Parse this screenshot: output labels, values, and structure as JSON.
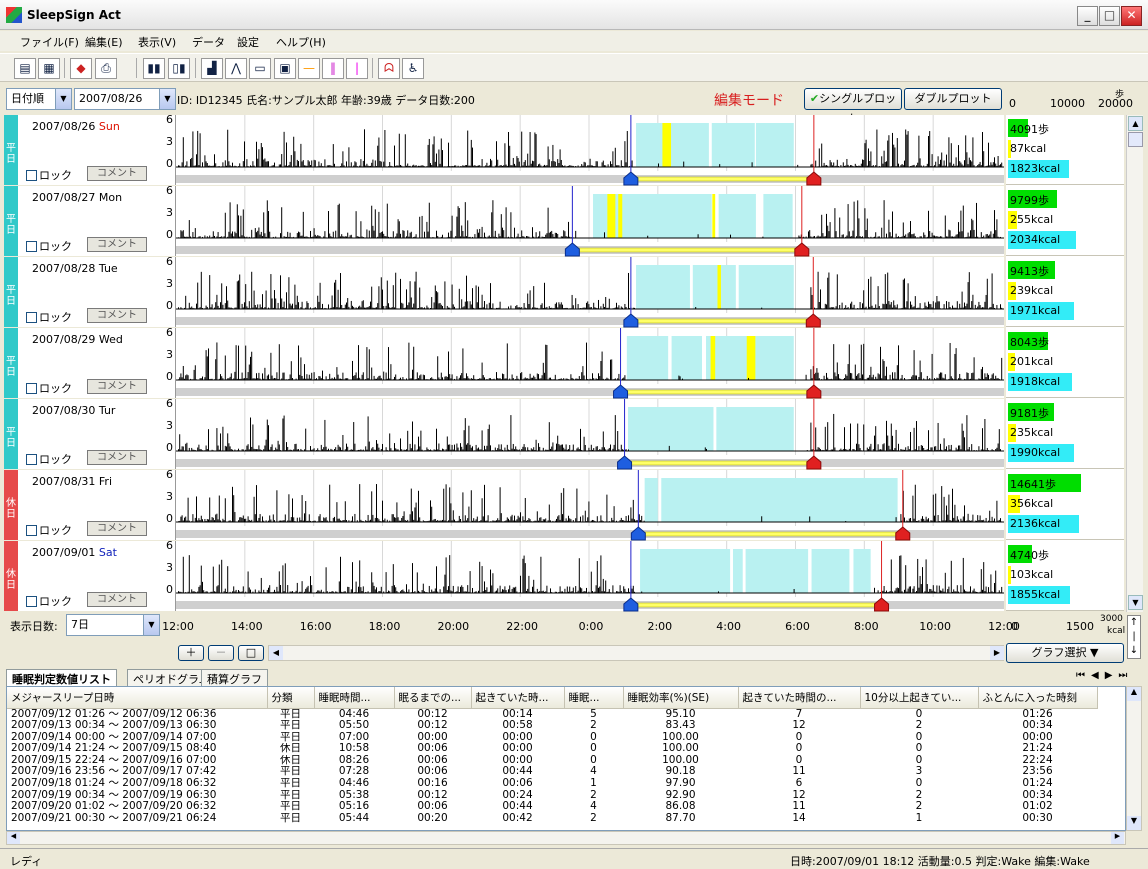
{
  "window": {
    "title": "SleepSign Act"
  },
  "menu": [
    "ファイル(F)",
    "編集(E)",
    "表示(V)",
    "データ",
    "設定",
    "ヘルプ(H)"
  ],
  "info": {
    "sort": "日付順",
    "date": "2007/08/26",
    "subject": "ID: ID12345  氏名:サンプル太郎  年齢:39歳  データ日数:200",
    "mode": "編集モード",
    "single_plot": "シングルプロット",
    "double_plot": "ダブルプロット",
    "scale_ticks": [
      "0",
      "10000",
      "20000"
    ],
    "scale_unit": "歩"
  },
  "colors": {
    "weekday": "#31c9c9",
    "holiday": "#e64a4a",
    "sleep": "#b9f1f1",
    "wake": "#ffff00",
    "steps": "#00dd00",
    "kcal": "#33ecf7",
    "mode": "#d81f1f"
  },
  "ytick": [
    "6",
    "3",
    "0"
  ],
  "rows": [
    {
      "date": "2007/08/26",
      "dow": "Sun",
      "dowclass": "sun",
      "day": "平日",
      "steps": "4091歩",
      "act": "87kcal",
      "total": "1823kcal",
      "stepsv": 4091,
      "actv": 87,
      "totalv": 1823,
      "sleepstart": "01:13",
      "sleepend": "06:32",
      "bands": [
        [
          "01:22",
          "03:29"
        ],
        [
          "03:34",
          "04:49"
        ],
        [
          "04:51",
          "05:57"
        ]
      ],
      "wakes": [
        [
          "02:08",
          "02:23"
        ]
      ]
    },
    {
      "date": "2007/08/27",
      "dow": "Mon",
      "dowclass": "",
      "day": "平日",
      "steps": "9799歩",
      "act": "255kcal",
      "total": "2034kcal",
      "stepsv": 9799,
      "actv": 255,
      "totalv": 2034,
      "sleepstart": "23:31",
      "sleepend": "06:11",
      "bands": [
        [
          "00:07",
          "03:34"
        ],
        [
          "03:46",
          "04:51"
        ],
        [
          "05:04",
          "05:55"
        ]
      ],
      "wakes": [
        [
          "00:32",
          "00:46"
        ],
        [
          "00:51",
          "00:58"
        ],
        [
          "03:35",
          "03:40"
        ]
      ]
    },
    {
      "date": "2007/08/28",
      "dow": "Tue",
      "dowclass": "",
      "day": "平日",
      "steps": "9413歩",
      "act": "239kcal",
      "total": "1971kcal",
      "stepsv": 9413,
      "actv": 239,
      "totalv": 1971,
      "sleepstart": "01:13",
      "sleepend": "06:31",
      "bands": [
        [
          "01:22",
          "02:56"
        ],
        [
          "03:01",
          "04:16"
        ],
        [
          "04:21",
          "05:57"
        ]
      ],
      "wakes": [
        [
          "03:44",
          "03:50"
        ]
      ]
    },
    {
      "date": "2007/08/29",
      "dow": "Wed",
      "dowclass": "",
      "day": "平日",
      "steps": "8043歩",
      "act": "201kcal",
      "total": "1918kcal",
      "stepsv": 8043,
      "actv": 201,
      "totalv": 1918,
      "sleepstart": "00:55",
      "sleepend": "06:32",
      "bands": [
        [
          "01:06",
          "02:18"
        ],
        [
          "02:24",
          "03:17"
        ],
        [
          "03:24",
          "05:57"
        ]
      ],
      "wakes": [
        [
          "03:32",
          "03:40"
        ],
        [
          "04:35",
          "04:50"
        ]
      ]
    },
    {
      "date": "2007/08/30",
      "dow": "Tur",
      "dowclass": "",
      "day": "平日",
      "steps": "9181歩",
      "act": "235kcal",
      "total": "1990kcal",
      "stepsv": 9181,
      "actv": 235,
      "totalv": 1990,
      "sleepstart": "01:02",
      "sleepend": "06:32",
      "bands": [
        [
          "01:08",
          "03:37"
        ],
        [
          "03:42",
          "05:57"
        ]
      ],
      "wakes": []
    },
    {
      "date": "2007/08/31",
      "dow": "Fri",
      "dowclass": "",
      "day": "休日",
      "steps": "14641歩",
      "act": "356kcal",
      "total": "2136kcal",
      "stepsv": 14641,
      "actv": 356,
      "totalv": 2136,
      "sleepstart": "01:26",
      "sleepend": "09:07",
      "bands": [
        [
          "01:37",
          "02:00"
        ],
        [
          "02:06",
          "08:58"
        ]
      ],
      "wakes": []
    },
    {
      "date": "2007/09/01",
      "dow": "Sat",
      "dowclass": "sat",
      "day": "休日",
      "steps": "4740歩",
      "act": "103kcal",
      "total": "1855kcal",
      "stepsv": 4740,
      "actv": 103,
      "totalv": 1855,
      "sleepstart": "01:13",
      "sleepend": "08:30",
      "bands": [
        [
          "01:29",
          "04:06"
        ],
        [
          "04:11",
          "04:28"
        ],
        [
          "04:33",
          "06:22"
        ],
        [
          "06:28",
          "07:34"
        ],
        [
          "07:41",
          "08:11"
        ]
      ],
      "wakes": []
    }
  ],
  "row_labels": {
    "lock": "ロック",
    "comment": "コメント"
  },
  "display_days": {
    "label": "表示日数:",
    "value": "7日"
  },
  "time_ticks": [
    "12:00",
    "14:00",
    "16:00",
    "18:00",
    "20:00",
    "22:00",
    "0:00",
    "2:00",
    "4:00",
    "6:00",
    "8:00",
    "10:00",
    "12:00"
  ],
  "right_axis": {
    "ticks": [
      "0",
      "1500",
      "3000"
    ],
    "unit": "kcal",
    "graph_select": "グラフ選択"
  },
  "tabs": [
    "睡眠判定数値リスト",
    "ペリオドグラム",
    "積算グラフ"
  ],
  "table": {
    "headers": [
      "メジャースリープ日時",
      "分類",
      "睡眠時間...",
      "眠るまでの...",
      "起きていた時...",
      "睡眠...",
      "睡眠効率(%)(SE)",
      "起きていた時間の...",
      "10分以上起きてい...",
      "ふとんに入った時刻"
    ],
    "rows": [
      [
        "2007/09/12 01:26 ～ 2007/09/12 06:36",
        "平日",
        "04:46",
        "00:12",
        "00:14",
        "5",
        "95.10",
        "7",
        "0",
        "01:26"
      ],
      [
        "2007/09/13 00:34 ～ 2007/09/13 06:30",
        "平日",
        "05:50",
        "00:12",
        "00:58",
        "2",
        "83.43",
        "12",
        "2",
        "00:34"
      ],
      [
        "2007/09/14 00:00 ～ 2007/09/14 07:00",
        "平日",
        "07:00",
        "00:00",
        "00:00",
        "0",
        "100.00",
        "0",
        "0",
        "00:00"
      ],
      [
        "2007/09/14 21:24 ～ 2007/09/15 08:40",
        "休日",
        "10:58",
        "00:06",
        "00:00",
        "0",
        "100.00",
        "0",
        "0",
        "21:24"
      ],
      [
        "2007/09/15 22:24 ～ 2007/09/16 07:00",
        "休日",
        "08:26",
        "00:06",
        "00:00",
        "0",
        "100.00",
        "0",
        "0",
        "22:24"
      ],
      [
        "2007/09/16 23:56 ～ 2007/09/17 07:42",
        "平日",
        "07:28",
        "00:06",
        "00:44",
        "4",
        "90.18",
        "11",
        "3",
        "23:56"
      ],
      [
        "2007/09/18 01:24 ～ 2007/09/18 06:32",
        "平日",
        "04:46",
        "00:16",
        "00:06",
        "1",
        "97.90",
        "6",
        "0",
        "01:24"
      ],
      [
        "2007/09/19 00:34 ～ 2007/09/19 06:30",
        "平日",
        "05:38",
        "00:12",
        "00:24",
        "2",
        "92.90",
        "12",
        "2",
        "00:34"
      ],
      [
        "2007/09/20 01:02 ～ 2007/09/20 06:32",
        "平日",
        "05:16",
        "00:06",
        "00:44",
        "4",
        "86.08",
        "11",
        "2",
        "01:02"
      ],
      [
        "2007/09/21 00:30 ～ 2007/09/21 06:24",
        "平日",
        "05:44",
        "00:20",
        "00:42",
        "2",
        "87.70",
        "14",
        "1",
        "00:30"
      ]
    ]
  },
  "status": {
    "left": "レディ",
    "right": "日時:2007/09/01 18:12  活動量:0.5 判定:Wake 編集:Wake"
  }
}
